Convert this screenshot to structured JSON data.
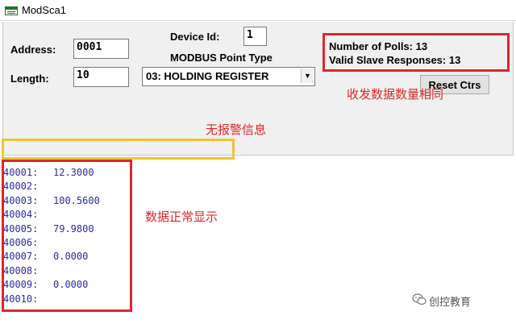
{
  "window": {
    "title": "ModSca1"
  },
  "form": {
    "address_label": "Address:",
    "address_value": "0001",
    "length_label": "Length:",
    "length_value": "10",
    "device_id_label": "Device Id:",
    "device_id_value": "1",
    "point_type_label": "MODBUS Point Type",
    "point_type_selected": "03: HOLDING REGISTER"
  },
  "stats": {
    "polls_text": "Number of Polls: 13",
    "responses_text": "Valid Slave Responses: 13",
    "reset_label": "Reset Ctrs"
  },
  "annotations": {
    "counts_equal": "收发数据数量相同",
    "no_alarm": "无报警信息",
    "data_ok": "数据正常显示"
  },
  "registers": [
    {
      "address": "40001:",
      "value": "12.3000"
    },
    {
      "address": "40002:",
      "value": ""
    },
    {
      "address": "40003:",
      "value": "100.5600"
    },
    {
      "address": "40004:",
      "value": ""
    },
    {
      "address": "40005:",
      "value": "79.9800"
    },
    {
      "address": "40006:",
      "value": ""
    },
    {
      "address": "40007:",
      "value": "0.0000"
    },
    {
      "address": "40008:",
      "value": ""
    },
    {
      "address": "40009:",
      "value": "0.0000"
    },
    {
      "address": "40010:",
      "value": ""
    }
  ],
  "watermark": {
    "text": "创控教育",
    "icon": "wechat-icon"
  },
  "colors": {
    "annotation": "#d9282d",
    "highlight_yellow": "#f1c232",
    "register_text": "#2b2b9e"
  }
}
